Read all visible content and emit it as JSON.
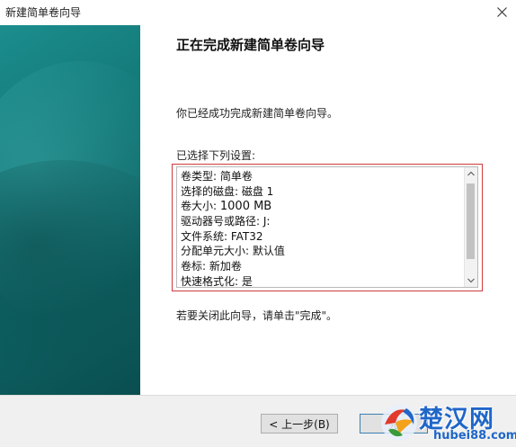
{
  "window": {
    "title": "新建简单卷向导"
  },
  "content": {
    "heading": "正在完成新建简单卷向导",
    "intro": "你已经成功完成新建简单卷向导。",
    "settings_label": "已选择下列设置:",
    "settings": [
      "卷类型: 简单卷",
      "选择的磁盘: 磁盘 1",
      "卷大小:",
      "驱动器号或路径: J:",
      "文件系统: FAT32",
      "分配单元大小: 默认值",
      "卷标: 新加卷",
      "快速格式化: 是"
    ],
    "volume_size_value": "1000 MB",
    "closing_note": "若要关闭此向导，请单击\"完成\"。"
  },
  "buttons": {
    "back": "< 上一步(B)",
    "finish": "完"
  },
  "watermark": {
    "brand": "楚汉网",
    "url": "hubei88.com"
  },
  "colors": {
    "sidebar_teal": "#137777",
    "highlight_red": "#d13a3a",
    "watermark_blue": "#1f66c8"
  },
  "icons": {
    "close": "close-icon",
    "scroll_up": "chevron-up-icon",
    "scroll_down": "chevron-down-icon",
    "logo": "watermark-logo-icon"
  }
}
